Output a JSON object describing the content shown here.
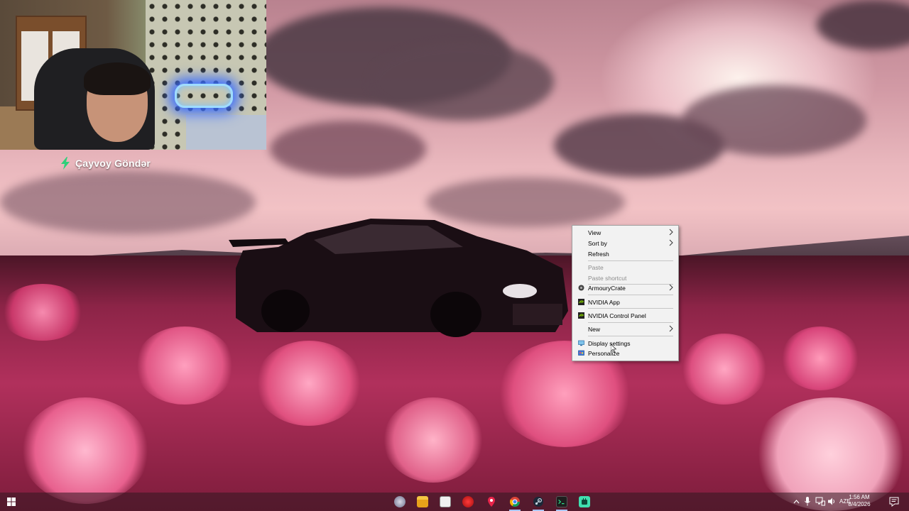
{
  "overlay": {
    "cta_label": "Çayvoy Göndər"
  },
  "context_menu": {
    "items": [
      {
        "label": "View",
        "submenu": true,
        "disabled": false
      },
      {
        "label": "Sort by",
        "submenu": true,
        "disabled": false
      },
      {
        "label": "Refresh",
        "submenu": false,
        "disabled": false
      },
      {
        "label": "Paste",
        "submenu": false,
        "disabled": true
      },
      {
        "label": "Paste shortcut",
        "submenu": false,
        "disabled": true
      },
      {
        "label": "ArmouryCrate",
        "submenu": true,
        "disabled": false,
        "icon": "armoury-crate-icon"
      },
      {
        "label": "NVIDIA App",
        "submenu": false,
        "disabled": false,
        "icon": "nvidia-icon"
      },
      {
        "label": "NVIDIA Control Panel",
        "submenu": false,
        "disabled": false,
        "icon": "nvidia-icon"
      },
      {
        "label": "New",
        "submenu": true,
        "disabled": false
      },
      {
        "label": "Display settings",
        "submenu": false,
        "disabled": false,
        "icon": "display-icon"
      },
      {
        "label": "Personalize",
        "submenu": false,
        "disabled": false,
        "icon": "personalize-icon"
      }
    ]
  },
  "taskbar": {
    "start_icon": "windows-start-icon",
    "pinned": [
      "app-icon",
      "file-explorer-icon",
      "calendar-app-icon",
      "red-app-icon",
      "location-pin-app-icon",
      "chrome-icon",
      "steam-icon",
      "terminal-icon",
      "green-app-icon"
    ],
    "tray": {
      "language": "AZE",
      "time": "1:56 AM",
      "date": "8/4/2026"
    }
  },
  "colors": {
    "accent_nvidia": "#76b900",
    "menu_bg": "#f2f2f2",
    "cta_bolt": "#2fd07a"
  }
}
